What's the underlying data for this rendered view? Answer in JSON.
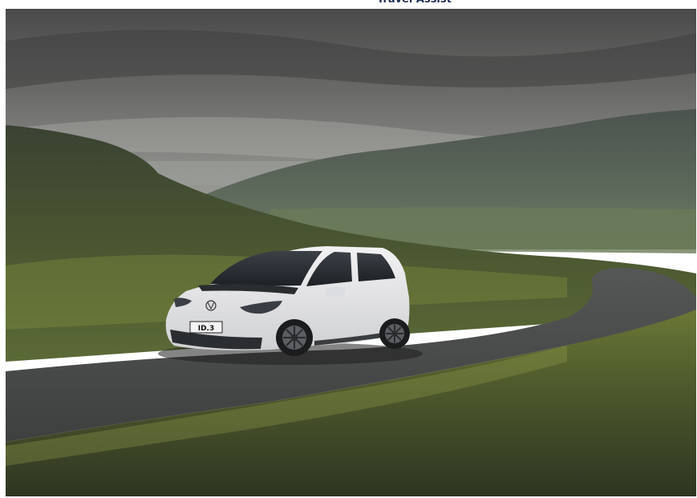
{
  "caption": "Travel Assist",
  "photo": {
    "subject": "car-on-mountain-road-photo",
    "license_plate": "ID.3",
    "colors": {
      "sky_top": "#4f4f4f",
      "sky_bottom": "#8c8c88",
      "hill_far": "#4e5a50",
      "hill_left": "#3c4a2f",
      "road": "#4a4c4b",
      "grass_front": "#4a5a2c",
      "car_body": "#e6e6e8"
    }
  }
}
